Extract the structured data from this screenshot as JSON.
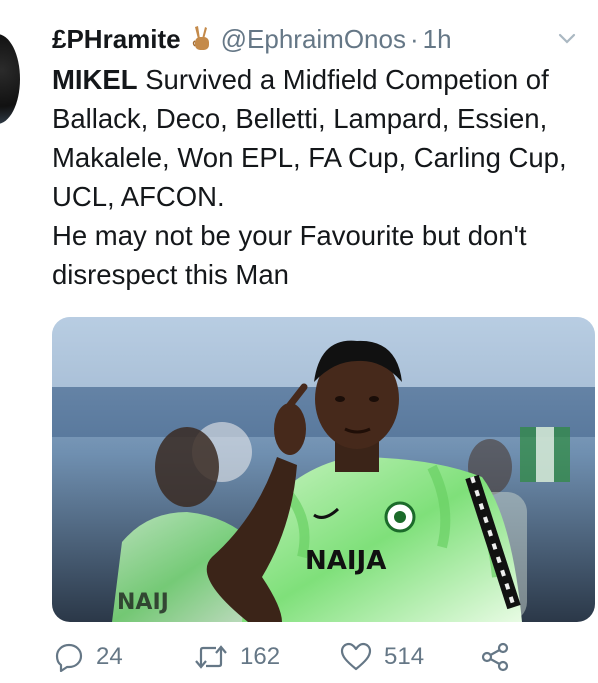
{
  "tweet": {
    "display_name": "£PHramite",
    "handle": "@EphraimOnos",
    "separator": "·",
    "time": "1h",
    "text_bold": "MIKEL",
    "text_rest": " Survived a Midfield Competion of Ballack, Deco, Belletti, Lampard, Essien, Makalele, Won EPL, FA Cup, Carling Cup, UCL, AFCON.",
    "text_line2": "He may not be your Favourite but don't disrespect this Man",
    "emoji": "victory-hand-emoji"
  },
  "media": {
    "jersey_text_front": "NAIJA",
    "jersey_text_back": "NAIJ"
  },
  "actions": {
    "reply_count": "24",
    "retweet_count": "162",
    "like_count": "514"
  },
  "colors": {
    "text": "#14171a",
    "secondary": "#657786",
    "jersey_green": "#7fe07a"
  }
}
